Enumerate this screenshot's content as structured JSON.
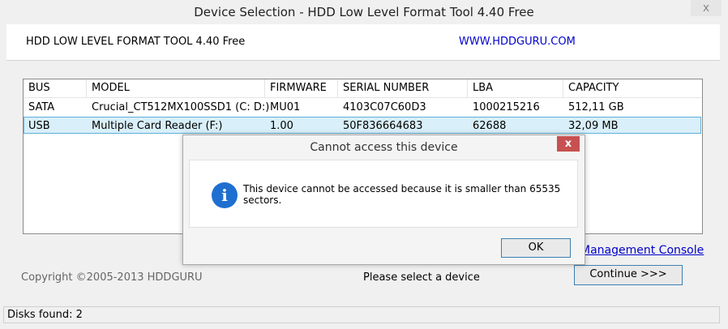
{
  "window": {
    "title": "Device Selection - HDD Low Level Format Tool 4.40   Free",
    "close_icon": "x"
  },
  "header": {
    "title": "HDD LOW LEVEL FORMAT TOOL 4.40    Free",
    "link": "WWW.HDDGURU.COM"
  },
  "list": {
    "columns": [
      "BUS",
      "MODEL",
      "FIRMWARE",
      "SERIAL NUMBER",
      "LBA",
      "CAPACITY"
    ],
    "rows": [
      [
        "SATA",
        "Crucial_CT512MX100SSD1 (C: D:)",
        "MU01",
        "4103C07C60D3",
        "1000215216",
        "512,11 GB"
      ],
      [
        "USB",
        "Multiple Card  Reader (F:)",
        "1.00",
        "50F836664683",
        "62688",
        "32,09 MB"
      ]
    ]
  },
  "links": {
    "management_console": "Management Console"
  },
  "footer": {
    "copyright": "Copyright ©2005-2013 HDDGURU",
    "select_msg": "Please select a device",
    "continue_label": "Continue >>>",
    "status": "Disks found: 2"
  },
  "dialog": {
    "title": "Cannot access this device",
    "close_icon": "x",
    "message": "This device cannot be accessed because it is smaller than 65535 sectors.",
    "icon": "i",
    "ok_label": "OK"
  }
}
